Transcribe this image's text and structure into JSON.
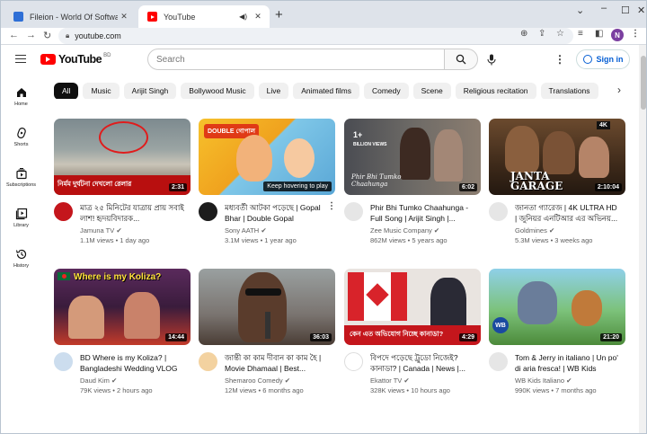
{
  "browser": {
    "tabs": [
      {
        "title": "Fileion - World Of Software"
      },
      {
        "title": "YouTube"
      }
    ],
    "url": "youtube.com",
    "profile_initial": "N"
  },
  "header": {
    "logo_text": "YouTube",
    "country_code": "BD",
    "search_placeholder": "Search",
    "sign_in": "Sign in"
  },
  "sidebar": [
    {
      "label": "Home",
      "icon": "home-icon"
    },
    {
      "label": "Shorts",
      "icon": "shorts-icon"
    },
    {
      "label": "Subscriptions",
      "icon": "subscriptions-icon"
    },
    {
      "label": "Library",
      "icon": "library-icon"
    },
    {
      "label": "History",
      "icon": "history-icon"
    }
  ],
  "chips": [
    "All",
    "Music",
    "Arijit Singh",
    "Bollywood Music",
    "Live",
    "Animated films",
    "Comedy",
    "Scene",
    "Religious recitation",
    "Translations"
  ],
  "videos": [
    {
      "title": "মাত্র ২৫ মিনিটের যাত্রায় প্রায় সবাই লাশ! হৃদয়বিদারক...",
      "channel": "Jamuna TV",
      "verified": true,
      "stats": "1.1M views • 1 day ago",
      "duration": "2:31"
    },
    {
      "title": "মধ্যবর্তী আটকা পড়েছে | Gopal Bhar | Double Gopal",
      "channel": "Sony AATH",
      "verified": true,
      "stats": "3.1M views • 1 year ago",
      "duration": "Keep hovering to play"
    },
    {
      "title": "Phir Bhi Tumko Chaahunga - Full Song | Arijit Singh |...",
      "channel": "Zee Music Company",
      "verified": true,
      "stats": "862M views • 5 years ago",
      "duration": "6:02"
    },
    {
      "title": "জানতা গ্যারেজ | 4K ULTRA HD | জুনিয়র এনটিআর এর অভিনয়...",
      "channel": "Goldmines",
      "verified": true,
      "stats": "5.3M views • 3 weeks ago",
      "duration": "2:10:04"
    },
    {
      "title": "BD Where is my Koliza? | Bangladeshi Wedding VLOG",
      "channel": "Daud Kim",
      "verified": true,
      "stats": "79K views • 2 hours ago",
      "duration": "14:44"
    },
    {
      "title": "জান্তী কা কাম দীবান কা কাম হৈ | Movie Dhamaal | Best...",
      "channel": "Shemaroo Comedy",
      "verified": true,
      "stats": "12M views • 6 months ago",
      "duration": "36:03"
    },
    {
      "title": "বিপদে পড়েছে ট্রুডো নিজেই? কানাডা? | Canada | News |...",
      "channel": "Ekattor TV",
      "verified": true,
      "stats": "328K views • 10 hours ago",
      "duration": "4:29"
    },
    {
      "title": "Tom & Jerry in italiano | Un po' di aria fresca! | WB Kids",
      "channel": "WB Kids Italiano",
      "verified": true,
      "stats": "990K views • 7 months ago",
      "duration": "21:20"
    }
  ],
  "thumb_captions": [
    {
      "text": "নির্মম দুর্ঘটনা দেখলো রেলার"
    },
    {
      "text": "DOUBLE গোপাল"
    },
    {
      "text": "Phir Bhi Tumko Chaahunga"
    },
    {
      "text": "JANTA GARAGE"
    },
    {
      "text": "Where is my Koliza?"
    },
    {
      "text": ""
    },
    {
      "text": "কেন এত অভিযোগ নিচ্ছে কানাডা?"
    },
    {
      "text": ""
    }
  ]
}
